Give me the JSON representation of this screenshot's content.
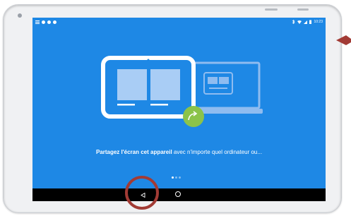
{
  "caption": {
    "bold": "Partagez l'écran cet appareil",
    "rest": " avec n'importe quel ordinateur ou..."
  },
  "status": {
    "time": "10:23"
  },
  "pager": {
    "count": 3,
    "active": 0
  },
  "colors": {
    "screen_bg": "#1e88e5",
    "cast_button": "#8bc34a",
    "highlight": "#a23b35"
  },
  "icons": {
    "back": "back-icon",
    "home": "home-icon",
    "cast": "share-arrow-icon"
  }
}
